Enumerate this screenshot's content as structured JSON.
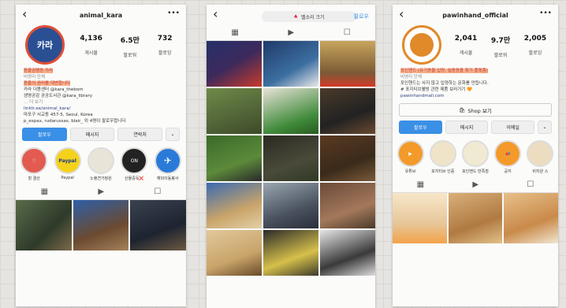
{
  "profile1": {
    "username": "animal_kara",
    "avatar_text": "카라",
    "stats": [
      {
        "value": "4,136",
        "label": "게시물"
      },
      {
        "value": "6.5만",
        "label": "팔로워"
      },
      {
        "value": "732",
        "label": "팔로잉"
      }
    ],
    "bio_name": "동물권행동 카라",
    "bio_category": "비영리 단체",
    "bio_line1": "동물의 권리를 대변합니다",
    "bio_line2": "카라 더봄센터 @kara_thebom",
    "bio_line3": "생명공감 공공도서관 @kara_library",
    "bio_more": "… 더 보기",
    "bio_link": "linktr.ee/animal_kara/",
    "bio_address": "마포구 서교동 457-5, Seoul, Korea",
    "bio_followed": "p_expax, rudarussas, blair_ 외 4명이 팔로우합니다",
    "buttons": [
      "팔로우",
      "메시지",
      "연락처"
    ],
    "highlights": [
      "힐 결산",
      "Paypal",
      "노랭견가정원",
      "산물중독❌",
      "해외이동봉사"
    ]
  },
  "feed": {
    "search_text": "벨소리 크기",
    "follow_label": "팔로우"
  },
  "profile3": {
    "username": "pawinhand_official",
    "stats": [
      {
        "value": "2,041",
        "label": "게시물"
      },
      {
        "value": "9.7만",
        "label": "팔로워"
      },
      {
        "value": "2,005",
        "label": "팔로잉"
      }
    ],
    "bio_name": "포인핸드 (유기동물 입양, 실종동물 찾기 플랫폼)",
    "bio_category": "비영리 단체",
    "bio_line1": "포인핸드는 사지 않고 입양하는 문화를 만듭니다.",
    "bio_line2": "# 포지티브웰빙 관련 제품 보러가기 🧡",
    "bio_link": "pawinhandmall.com",
    "shop_label": "Shop 보기",
    "buttons": [
      "팔로우",
      "메시지",
      "이메일"
    ],
    "highlights": [
      "유튜브",
      "포지티브 인증",
      "포인핸드 만족점",
      "공지",
      "비지원 스"
    ]
  }
}
